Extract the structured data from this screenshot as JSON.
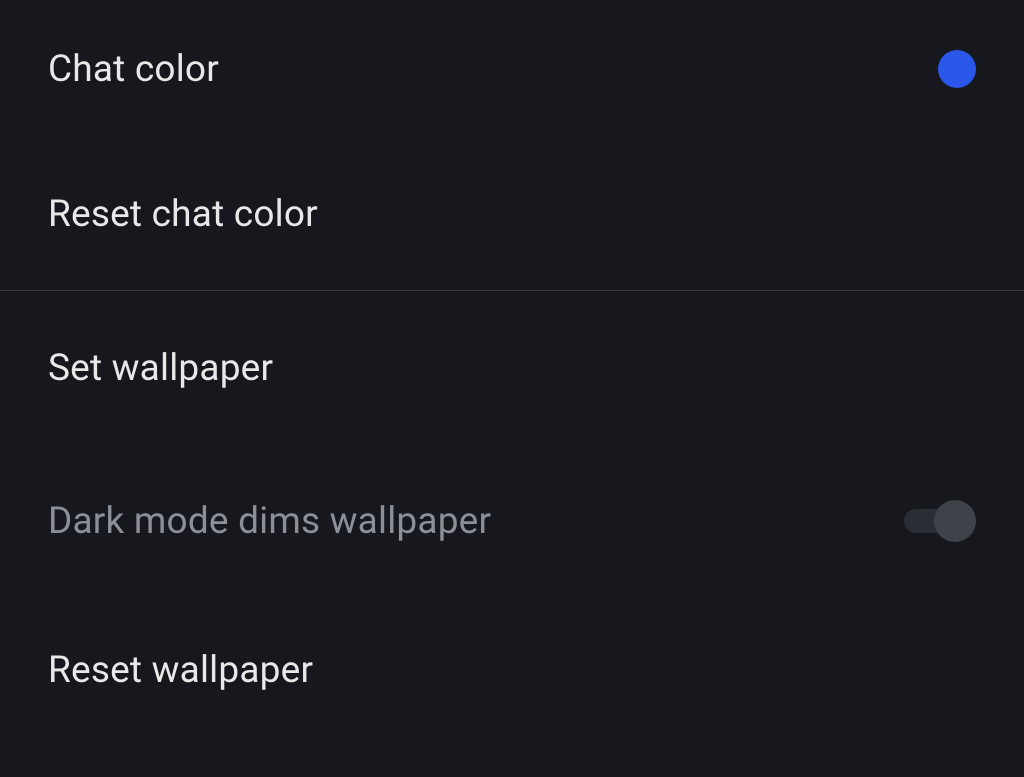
{
  "chatColor": {
    "label": "Chat color",
    "swatchColor": "#2a56ea"
  },
  "resetChatColor": {
    "label": "Reset chat color"
  },
  "setWallpaper": {
    "label": "Set wallpaper"
  },
  "darkModeDims": {
    "label": "Dark mode dims wallpaper",
    "enabled": false
  },
  "resetWallpaper": {
    "label": "Reset wallpaper"
  }
}
